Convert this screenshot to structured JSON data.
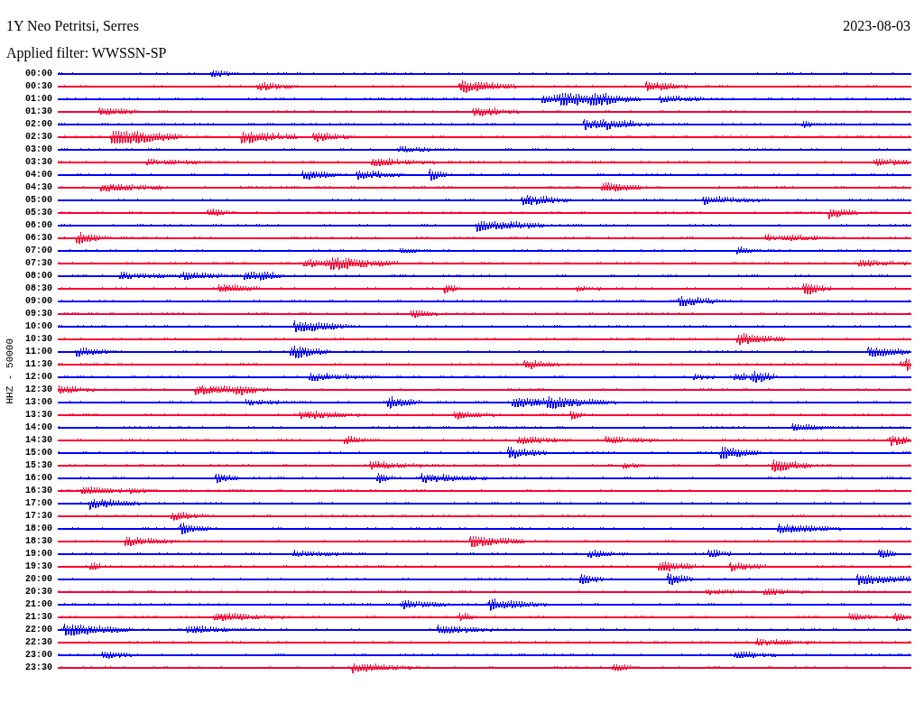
{
  "title": "1Y Neo Petritsi, Serres",
  "date": "2023-08-03",
  "filter": "Applied filter: WWSSN-SP",
  "axis_label": "HHZ - 50000",
  "trace_rows": [
    {
      "label": "00:00",
      "color": "#0000ff"
    },
    {
      "label": "00:30",
      "color": "#ff0033"
    },
    {
      "label": "01:00",
      "color": "#0000ff"
    },
    {
      "label": "01:30",
      "color": "#ff0033"
    },
    {
      "label": "02:00",
      "color": "#0000ff"
    },
    {
      "label": "02:30",
      "color": "#ff0033"
    },
    {
      "label": "03:00",
      "color": "#0000ff"
    },
    {
      "label": "03:30",
      "color": "#ff0033"
    },
    {
      "label": "04:00",
      "color": "#0000ff"
    },
    {
      "label": "04:30",
      "color": "#ff0033"
    },
    {
      "label": "05:00",
      "color": "#0000ff"
    },
    {
      "label": "05:30",
      "color": "#ff0033"
    },
    {
      "label": "06:00",
      "color": "#0000ff"
    },
    {
      "label": "06:30",
      "color": "#ff0033"
    },
    {
      "label": "07:00",
      "color": "#0000ff"
    },
    {
      "label": "07:30",
      "color": "#ff0033"
    },
    {
      "label": "08:00",
      "color": "#0000ff"
    },
    {
      "label": "08:30",
      "color": "#ff0033"
    },
    {
      "label": "09:00",
      "color": "#0000ff"
    },
    {
      "label": "09:30",
      "color": "#ff0033"
    },
    {
      "label": "10:00",
      "color": "#0000ff"
    },
    {
      "label": "10:30",
      "color": "#ff0033"
    },
    {
      "label": "11:00",
      "color": "#0000ff"
    },
    {
      "label": "11:30",
      "color": "#ff0033"
    },
    {
      "label": "12:00",
      "color": "#0000ff"
    },
    {
      "label": "12:30",
      "color": "#ff0033"
    },
    {
      "label": "13:00",
      "color": "#0000ff"
    },
    {
      "label": "13:30",
      "color": "#ff0033"
    },
    {
      "label": "14:00",
      "color": "#0000ff"
    },
    {
      "label": "14:30",
      "color": "#ff0033"
    },
    {
      "label": "15:00",
      "color": "#0000ff"
    },
    {
      "label": "15:30",
      "color": "#ff0033"
    },
    {
      "label": "16:00",
      "color": "#0000ff"
    },
    {
      "label": "16:30",
      "color": "#ff0033"
    },
    {
      "label": "17:00",
      "color": "#0000ff"
    },
    {
      "label": "17:30",
      "color": "#ff0033"
    },
    {
      "label": "18:00",
      "color": "#0000ff"
    },
    {
      "label": "18:30",
      "color": "#ff0033"
    },
    {
      "label": "19:00",
      "color": "#0000ff"
    },
    {
      "label": "19:30",
      "color": "#ff0033"
    },
    {
      "label": "20:00",
      "color": "#0000ff"
    },
    {
      "label": "20:30",
      "color": "#ff0033"
    },
    {
      "label": "21:00",
      "color": "#0000ff"
    },
    {
      "label": "21:30",
      "color": "#ff0033"
    },
    {
      "label": "22:00",
      "color": "#0000ff"
    },
    {
      "label": "22:30",
      "color": "#ff0033"
    },
    {
      "label": "23:00",
      "color": "#0000ff"
    },
    {
      "label": "23:30",
      "color": "#ff0033"
    }
  ]
}
